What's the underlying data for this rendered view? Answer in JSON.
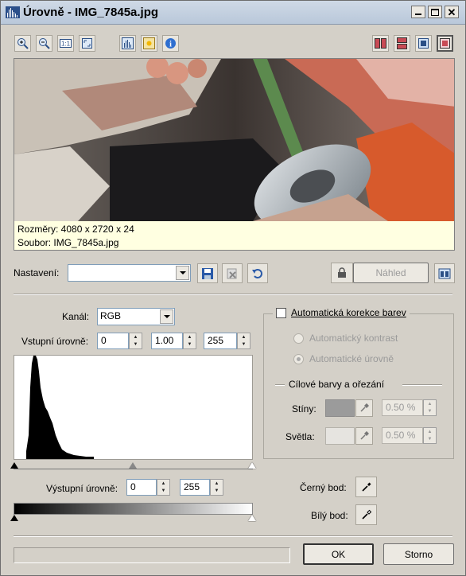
{
  "window": {
    "title": "Úrovně - IMG_7845a.jpg"
  },
  "preview": {
    "info_lines": [
      "Rozměry: 4080 x 2720 x 24",
      "Soubor: IMG_7845a.jpg"
    ]
  },
  "settings": {
    "label": "Nastavení:",
    "value": "",
    "preview_button": "Náhled"
  },
  "channel": {
    "label": "Kanál:",
    "value": "RGB"
  },
  "input_levels": {
    "label": "Vstupní úrovně:",
    "black": "0",
    "gamma": "1.00",
    "white": "255"
  },
  "output_levels": {
    "label": "Výstupní úrovně:",
    "black": "0",
    "white": "255"
  },
  "auto_correction": {
    "checkbox_label": "Automatická korekce barev",
    "option_contrast": "Automatický kontrast",
    "option_levels": "Automatické úrovně",
    "target_group": "Cílové barvy a ořezání",
    "shadows_label": "Stíny:",
    "shadows_value": "0.50 %",
    "highlights_label": "Světla:",
    "highlights_value": "0.50 %"
  },
  "points": {
    "black_label": "Černý bod:",
    "white_label": "Bílý bod:"
  },
  "buttons": {
    "ok": "OK",
    "cancel": "Storno"
  },
  "colors": {
    "title_bg": "#c2d0e2",
    "panel_bg": "#d4d0c8",
    "info_bg": "#ffffe1",
    "close_red": "#c0392b"
  }
}
